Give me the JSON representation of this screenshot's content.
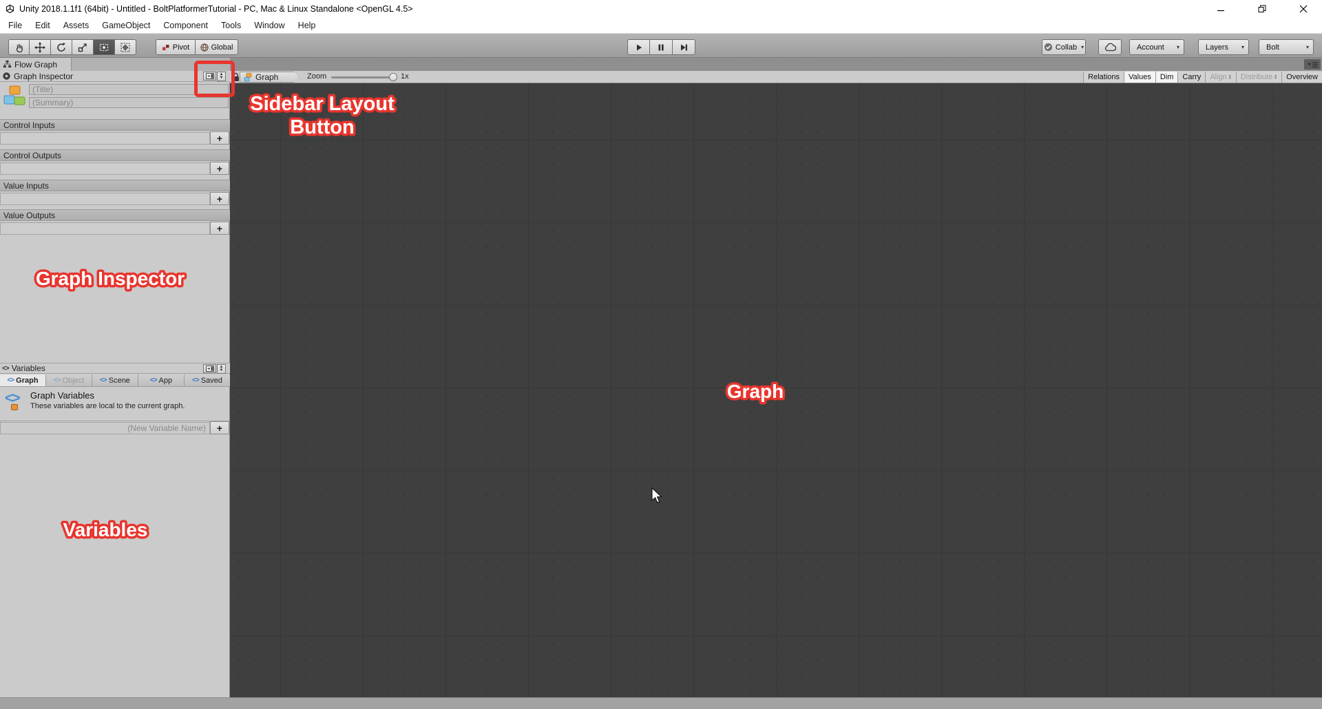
{
  "window": {
    "title": "Unity 2018.1.1f1 (64bit) - Untitled - BoltPlatformerTutorial - PC, Mac & Linux Standalone <OpenGL 4.5>"
  },
  "menu": {
    "items": [
      "File",
      "Edit",
      "Assets",
      "GameObject",
      "Component",
      "Tools",
      "Window",
      "Help"
    ]
  },
  "toolbar": {
    "pivot_label": "Pivot",
    "global_label": "Global",
    "collab_label": "Collab",
    "account_label": "Account",
    "layers_label": "Layers",
    "bolt_label": "Bolt"
  },
  "tabs": {
    "flow_graph_label": "Flow Graph"
  },
  "inspector": {
    "header": "Graph Inspector",
    "title_placeholder": "(Title)",
    "summary_placeholder": "(Summary)",
    "sections": [
      {
        "label": "Control Inputs"
      },
      {
        "label": "Control Outputs"
      },
      {
        "label": "Value Inputs"
      },
      {
        "label": "Value Outputs"
      }
    ],
    "add_label": "+"
  },
  "variables": {
    "header": "Variables",
    "tabs": [
      {
        "label": "Graph"
      },
      {
        "label": "Object"
      },
      {
        "label": "Scene"
      },
      {
        "label": "App"
      },
      {
        "label": "Saved"
      }
    ],
    "info_title": "Graph Variables",
    "info_desc": "These variables are local to the current graph.",
    "new_placeholder": "(New Variable Name)",
    "add_label": "+"
  },
  "graph": {
    "breadcrumb": "Graph",
    "zoom_label": "Zoom",
    "zoom_value": "1x",
    "toggles": [
      {
        "label": "Relations"
      },
      {
        "label": "Values"
      },
      {
        "label": "Dim"
      },
      {
        "label": "Carry"
      },
      {
        "label": "Align"
      },
      {
        "label": "Distribute"
      },
      {
        "label": "Overview"
      }
    ]
  },
  "annotations": {
    "sidebar_layout_line1": "Sidebar Layout",
    "sidebar_layout_line2": "Button",
    "graph_inspector": "Graph Inspector",
    "variables": "Variables",
    "graph": "Graph",
    "accent_color": "#e8352e"
  }
}
